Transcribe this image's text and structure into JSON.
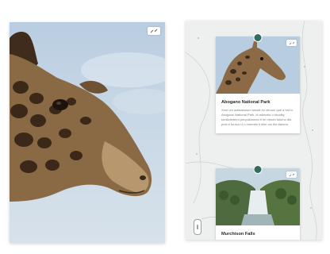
{
  "main_photo": {
    "subject": "giraffe",
    "expand_icon": "expand-icon"
  },
  "map": {
    "locations": [
      {
        "title": "Abogano National Park",
        "description": "Xem um adistaboium amatil for dimum que a trnt ic Abogano National Park. Iti adimatic u ritoality tomitcfinterm pimpukinmen tl tin rtmuth fulumu dts pmit e tourco U u mmmtm tl tillm um fint ttammr.",
        "thumb": "giraffe"
      },
      {
        "title": "Murchison Falls",
        "thumb": "waterfall"
      }
    ],
    "pin_color": "#2f6e5a"
  }
}
